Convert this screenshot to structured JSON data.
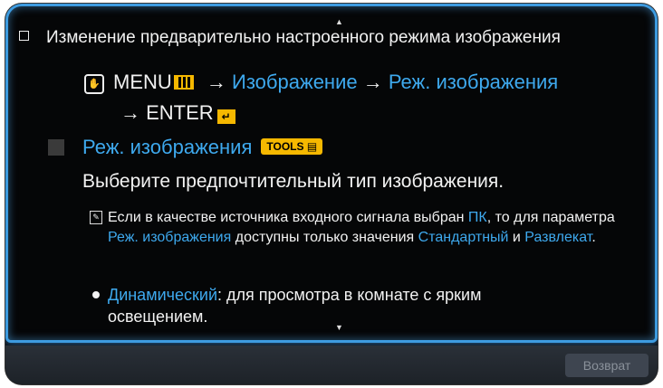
{
  "heading": "Изменение предварительно настроенного режима изображения",
  "menu_path": {
    "menu": "MENU",
    "arrow1": " → ",
    "item1": "Изображение",
    "arrow2": " → ",
    "item2": "Реж. изображения",
    "arrow3": "→ ENTER",
    "menu_icon": "menu-grid-icon",
    "enter_icon": "enter-icon",
    "remote_icon": "remote-hand-icon"
  },
  "section": {
    "title": "Реж. изображения",
    "tools_badge": "TOOLS"
  },
  "description": "Выберите предпочтительный тип изображения.",
  "note": {
    "part1": "Если в качестве источника входного сигнала выбран ",
    "pc": "ПК",
    "part2": ", то для параметра ",
    "param": "Реж. изображения",
    "part3": " доступны только значения ",
    "value1": "Стандартный",
    "part4": " и ",
    "value2": "Развлекат",
    "part5": "."
  },
  "bullet": {
    "term": "Динамический",
    "text": ": для просмотра в комнате с ярким освещением."
  },
  "footer": {
    "back_label": "Возврат"
  },
  "colors": {
    "accent": "#3ea9ee",
    "highlight": "#f6b800",
    "frame_glow": "#3d9be0"
  }
}
